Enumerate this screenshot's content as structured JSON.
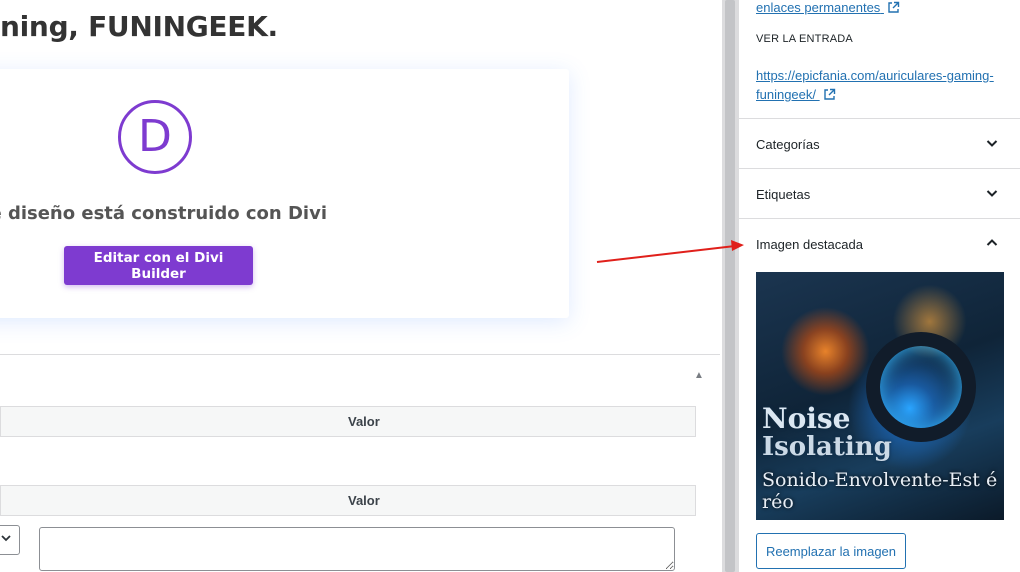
{
  "editor": {
    "post_title": "ning, FUNINGEEK.",
    "divi": {
      "logo_letter": "D",
      "message": "Este diseño está construido con Divi",
      "button_label": "Editar con el Divi Builder",
      "accent_color": "#7e3bd0"
    },
    "custom_fields": {
      "header_value_1": "Valor",
      "header_value_2": "Valor",
      "textarea_value": ""
    }
  },
  "sidebar": {
    "permalink_link": "enlaces permanentes",
    "view_entry_label": "VER LA ENTRADA",
    "entry_url": "https://epicfania.com/auriculares-gaming-funingeek/",
    "panels": [
      {
        "label": "Categorías",
        "state": "collapsed"
      },
      {
        "label": "Etiquetas",
        "state": "collapsed"
      },
      {
        "label": "Imagen destacada",
        "state": "expanded"
      }
    ],
    "featured_image": {
      "text_line1": "Noise",
      "text_line2": "Isolating",
      "text_line3": "Sonido-Envolvente-Est é réo"
    },
    "replace_button": "Reemplazar la imagen",
    "link_color": "#2271b1"
  },
  "annotation": {
    "arrow_color": "#e0201b"
  }
}
